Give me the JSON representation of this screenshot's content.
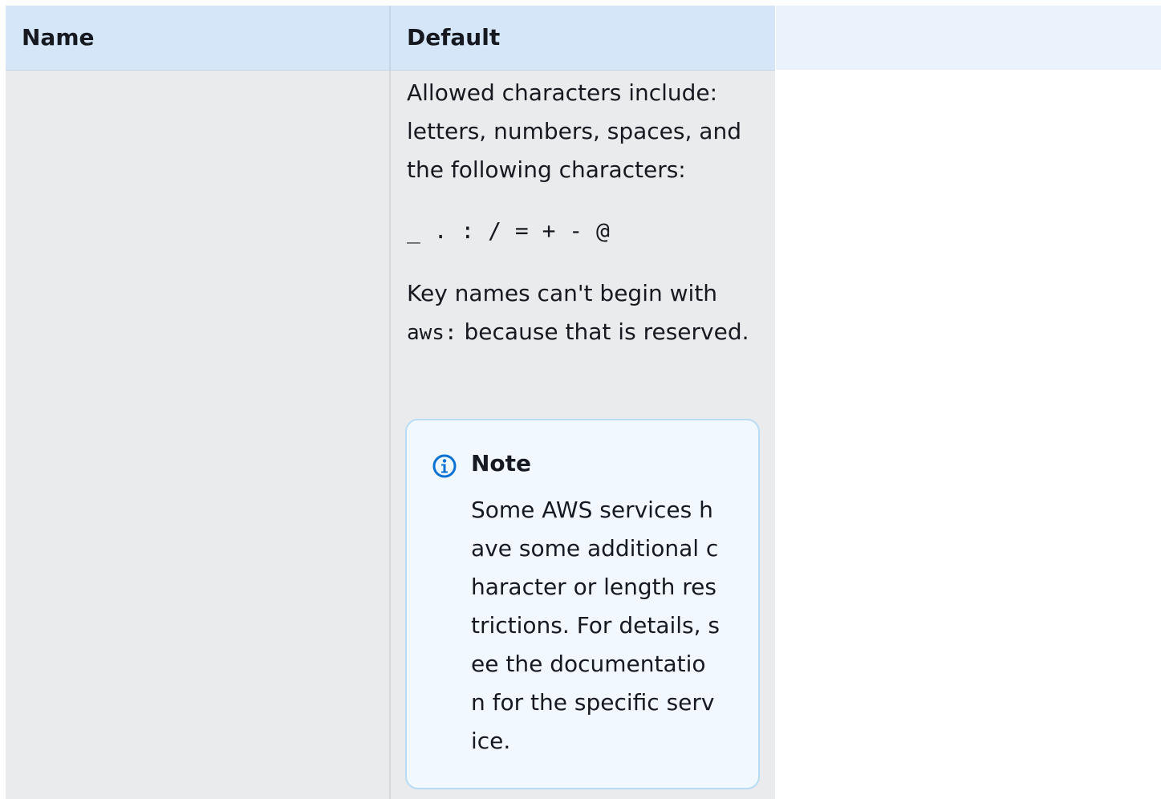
{
  "table": {
    "headers": [
      "Name",
      "Default",
      ""
    ],
    "default_cell": {
      "para1": "Allowed characters include: letters, numbers, spaces, and the following characters:",
      "allowed_chars": "_ . : / = + - @",
      "para2_prefix": "Key names can't begin with ",
      "para2_code": "aws:",
      "para2_suffix": " because that is reserved.",
      "note": {
        "title": "Note",
        "text": "Some AWS services have some additional character or length restrictions. For details, see the documentation for the specific service.",
        "icon": "info-icon",
        "icon_color": "#0972d3"
      }
    }
  }
}
